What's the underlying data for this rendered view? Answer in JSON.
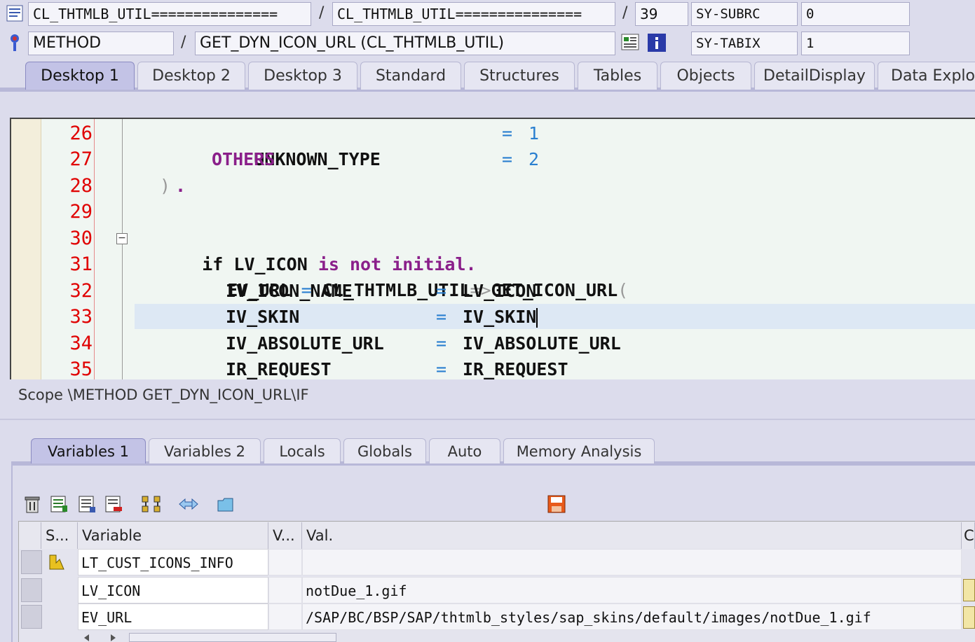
{
  "header": {
    "program": "CL_THTMLB_UTIL===============",
    "include": "CL_THTMLB_UTIL===============",
    "line": "39",
    "event_type": "METHOD",
    "event": "GET_DYN_ICON_URL (CL_THTMLB_UTIL)",
    "sysfield1_name": "SY-SUBRC",
    "sysfield1_value": "0",
    "sysfield2_name": "SY-TABIX",
    "sysfield2_value": "1",
    "separator": "/"
  },
  "desktop_tabs": [
    "Desktop 1",
    "Desktop 2",
    "Desktop 3",
    "Standard",
    "Structures",
    "Tables",
    "Objects",
    "DetailDisplay",
    "Data Explorer"
  ],
  "code": {
    "line_numbers": [
      "26",
      "27",
      "28",
      "29",
      "30",
      "31",
      "32",
      "33",
      "34",
      "35"
    ],
    "l26_name": "UNKNOWN_TYPE",
    "l26_eq": "=",
    "l26_val": "1",
    "l27_name": "OTHERS",
    "l27_eq": "=",
    "l27_val": "2",
    "l28_paren": ")",
    "l28_dot": ".",
    "l30_if": "if",
    "l30_var": "LV_ICON",
    "l30_kw": "is not initial.",
    "l31_lhs": "EV_URL",
    "l31_eq": "=",
    "l31_cls": "CL_THTMLB_UTIL",
    "l31_arrow": "=>",
    "l31_meth": "GET_ICON_URL",
    "l31_paren": "(",
    "l32_p": "IV_ICON_NAME",
    "l32_eq": "=",
    "l32_v": "LV_ICON",
    "l33_p": "IV_SKIN",
    "l33_eq": "=",
    "l33_v": "IV_SKIN",
    "l34_p": "IV_ABSOLUTE_URL",
    "l34_eq": "=",
    "l34_v": "IV_ABSOLUTE_URL",
    "l35_p": "IR_REQUEST",
    "l35_eq": "=",
    "l35_v": "IR_REQUEST",
    "fold_symbol": "−"
  },
  "scope": "Scope \\METHOD GET_DYN_ICON_URL\\IF",
  "variable_tabs": [
    "Variables 1",
    "Variables 2",
    "Locals",
    "Globals",
    "Auto",
    "Memory Analysis"
  ],
  "table": {
    "headers": [
      "S...",
      "Variable",
      "V...",
      "Val.",
      "C"
    ],
    "rows": [
      {
        "variable": "LT_CUST_ICONS_INFO",
        "value": ""
      },
      {
        "variable": "LV_ICON",
        "value": "notDue_1.gif"
      },
      {
        "variable": "EV_URL",
        "value": "/SAP/BC/BSP/SAP/thtmlb_styles/sap_skins/default/images/notDue_1.gif"
      }
    ]
  },
  "colors": {
    "background": "#dcdcec",
    "active_tab": "#c3c3e6",
    "line_number": "#e00000",
    "keyword": "#8a1f8a",
    "literal": "#2a7fd0"
  }
}
